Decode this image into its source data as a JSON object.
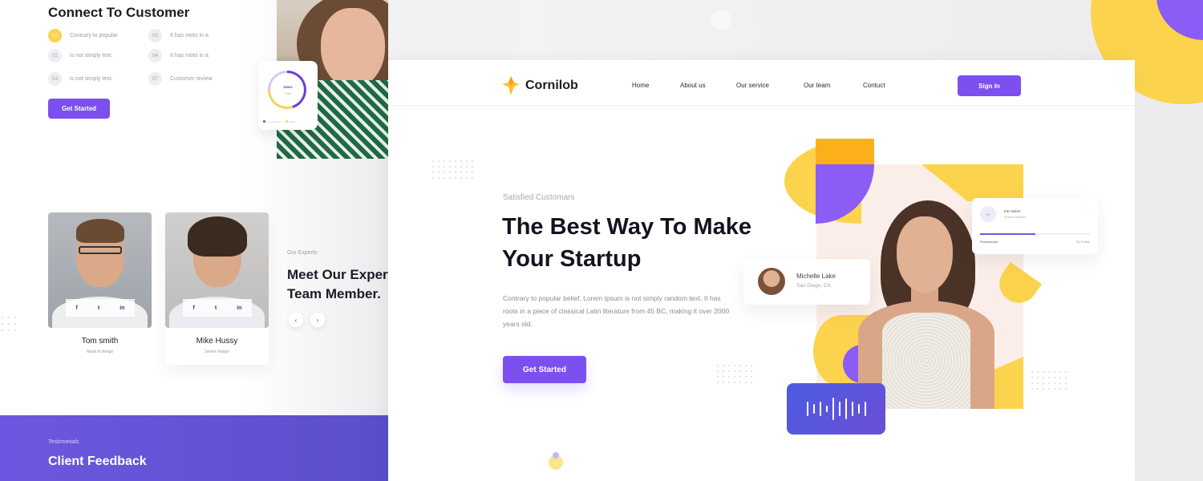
{
  "colors": {
    "primary": "#7c4ff0",
    "accent_yellow": "#fcd34d",
    "accent_purple": "#8b5cf6",
    "testimonial_bg": "#6c58e0",
    "text_dark": "#1c1c28"
  },
  "left_page": {
    "connect_section": {
      "title": "Connect To Customer",
      "features": [
        {
          "num": "01",
          "text": "Contrary to popular",
          "active": true
        },
        {
          "num": "02",
          "text": "is not simply  text.",
          "active": false
        },
        {
          "num": "03",
          "text": "is not simply  text.",
          "active": false
        },
        {
          "num": "03",
          "text": "It has roots in a",
          "active": false
        },
        {
          "num": "04",
          "text": "It has roots in a",
          "active": false
        },
        {
          "num": "07",
          "text": "Customer review",
          "active": false
        }
      ],
      "button_label": "Get Started"
    },
    "donut_card": {
      "value": "$5500",
      "sub": "Total",
      "legend": [
        "Lorem ipsum",
        "Dolor"
      ]
    },
    "team": {
      "members": [
        {
          "name": "Tom smith",
          "role": "Head of design",
          "social": [
            "f",
            "t",
            "in"
          ]
        },
        {
          "name": "Mike Hussy",
          "role": "Senior design",
          "social": [
            "f",
            "t",
            "in"
          ]
        }
      ],
      "label": "Our Experts",
      "title_line1": "Meet Our Expert",
      "title_line2": "Team Member.",
      "prev_label": "‹",
      "next_label": "›"
    },
    "testimonials": {
      "label": "Testimonials",
      "title": "Client Feedback"
    }
  },
  "main_page": {
    "brand": "Cornilob",
    "nav": [
      "Home",
      "About us",
      "Our service",
      "Our team",
      "Contuct"
    ],
    "signin_label": "Sign In",
    "hero": {
      "kicker": "Satisfied Customars",
      "title_line1": "The Best Way To Make",
      "title_line2": "Your Startup",
      "body": "Contrary to popular belief, Lorem Ipsum is not simply random text. It has roots in a piece of classical Latin literature from 45 BC, making it over 2000 years old.",
      "button_label": "Get Started"
    },
    "profile_card": {
      "name": "Michelle Lake",
      "location": "San Diego, CA"
    },
    "skill_card": {
      "initials": "IH",
      "name": "Irle Hiuber",
      "role": "Product Designer",
      "more": "···",
      "label": "Professional",
      "points": "75( Points",
      "progress": 0.5
    },
    "audio_card": {
      "levels": [
        0.45,
        0.3,
        0.45,
        0.2,
        0.7,
        0.45,
        0.65,
        0.45,
        0.3,
        0.45
      ]
    }
  }
}
